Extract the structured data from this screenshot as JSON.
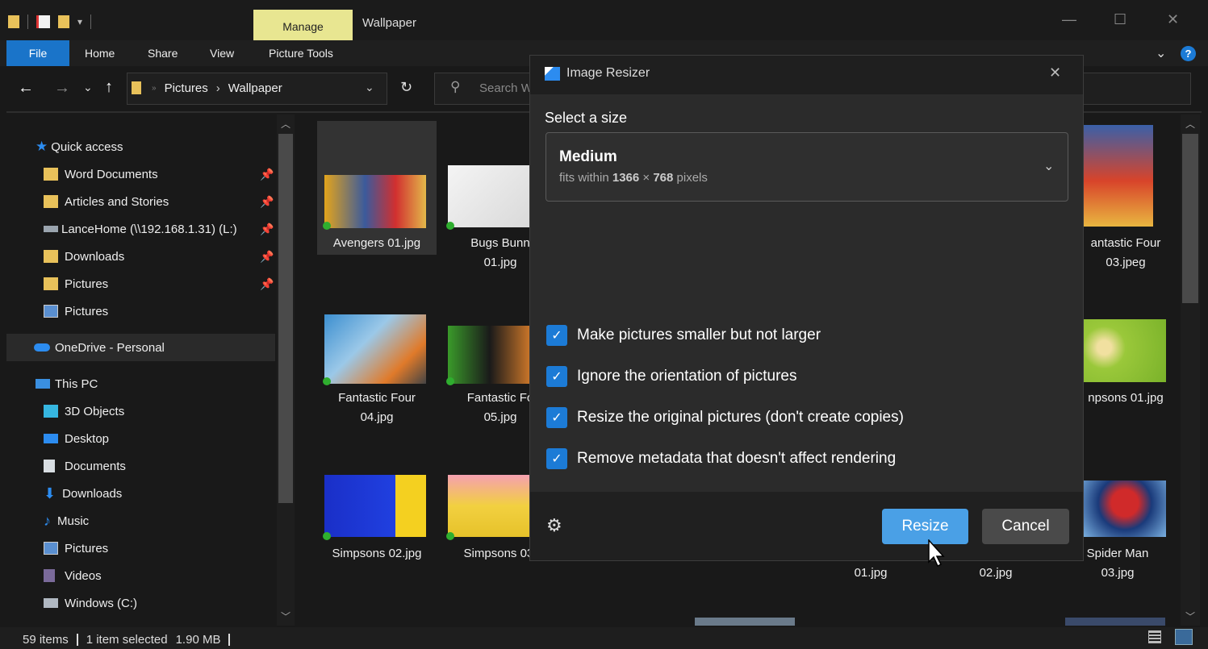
{
  "titlebar": {
    "manage_tab": "Manage",
    "window_title": "Wallpaper"
  },
  "ribbon": {
    "tabs": [
      "File",
      "Home",
      "Share",
      "View",
      "Picture Tools"
    ]
  },
  "address": {
    "crumbs": [
      "Pictures",
      "Wallpaper"
    ],
    "search_placeholder": "Search W"
  },
  "sidebar": {
    "quick_access": "Quick access",
    "quick_items": [
      "Word Documents",
      "Articles and Stories",
      "LanceHome (\\\\192.168.1.31) (L:)",
      "Downloads",
      "Pictures"
    ],
    "pictures_lib": "Pictures",
    "onedrive": "OneDrive - Personal",
    "this_pc": "This PC",
    "pc_items": [
      "3D Objects",
      "Desktop",
      "Documents",
      "Downloads",
      "Music",
      "Pictures",
      "Videos",
      "Windows (C:)"
    ]
  },
  "files": {
    "r1": {
      "a": "Avengers 01.jpg",
      "b1": "Bugs Bunn",
      "b2": "01.jpg",
      "c1": "antastic Four",
      "c2": "03.jpeg"
    },
    "r2": {
      "a1": "Fantastic Four",
      "a2": "04.jpg",
      "b1": "Fantastic Fo",
      "b2": "05.jpg",
      "c": "npsons 01.jpg"
    },
    "r3": {
      "a": "Simpsons 02.jpg",
      "b": "Simpsons 03.",
      "c": "01.jpg",
      "d": "02.jpg",
      "e1": "Spider Man",
      "e2": "03.jpg"
    }
  },
  "dialog": {
    "title": "Image Resizer",
    "select_label": "Select a size",
    "size_name": "Medium",
    "size_desc_pre": "fits within ",
    "size_w": "1366",
    "size_x": " × ",
    "size_h": "768",
    "size_desc_post": " pixels",
    "options": [
      "Make pictures smaller but not larger",
      "Ignore the orientation of pictures",
      "Resize the original pictures (don't create copies)",
      "Remove metadata that doesn't affect rendering"
    ],
    "resize_label": "Resize",
    "cancel_label": "Cancel"
  },
  "status": {
    "items": "59 items",
    "selected": "1 item selected",
    "size": "1.90 MB"
  },
  "colors": {
    "accent": "#1c7bd6",
    "resize_button": "#4aa0e6",
    "manage_tab": "#e8e691"
  }
}
